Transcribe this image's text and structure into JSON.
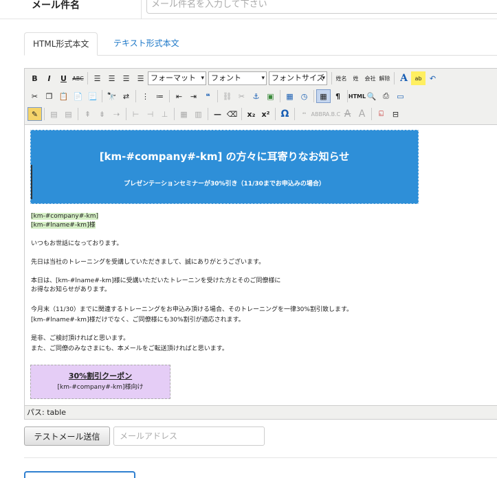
{
  "subject": {
    "label": "メール件名",
    "placeholder": "メール件名を入力して下さい"
  },
  "tabs": [
    {
      "label": "HTML形式本文",
      "active": true
    },
    {
      "label": "テキスト形式本文",
      "active": false
    }
  ],
  "toolbar": {
    "row1": {
      "bold": "B",
      "italic": "I",
      "underline": "U",
      "strike": "ABC",
      "format": "フォーマット",
      "font": "フォント",
      "fontsize": "フォントサイズ",
      "tag_name": "姓名",
      "tag_last": "姓",
      "tag_company": "会社",
      "tag_unsub": "解除",
      "font_color": "A",
      "highlight": "ab"
    },
    "row2": {
      "omega_none": "",
      "html_label": "HTML"
    },
    "row3": {
      "omega": "Ω",
      "sub": "x₂",
      "sup": "x²"
    }
  },
  "banner": {
    "title": "[km-#company#-km] の方々に耳寄りなお知らせ",
    "subtitle": "プレゼンテーションセミナーが30%引き（11/30までお申込みの場合）"
  },
  "body": {
    "company": "[km-#company#-km]",
    "name": "[km-#lname#-km]様",
    "greeting": "いつもお世話になっております。",
    "thanks": "先日は当社のトレーニングを受講していただきまして、誠にありがとうございます。",
    "para1_l1": "本日は、[km-#lname#-km]様に受講いただいたトレーニンを受けた方とそのご同僚様に",
    "para1_l2": "お得なお知らせがあります。",
    "para2_l1": "今月末（11/30）までに関連するトレーニングをお申込み頂ける場合、そのトレーニングを一律30%割引致します。",
    "para2_l2": "[km-#lname#-km]様だけでなく、ご同僚様にも30%割引が適応されます。",
    "para3_l1": "是非、ご検討頂ければと思います。",
    "para3_l2": "また、ご同僚のみなさまにも、本メールをご転送頂ければと思います。"
  },
  "coupon": {
    "title": "30%割引クーポン",
    "subtitle": "[km-#company#-km]様向け"
  },
  "path": {
    "label": "パス: table"
  },
  "test": {
    "button": "テストメール送信",
    "placeholder": "メールアドレス"
  }
}
